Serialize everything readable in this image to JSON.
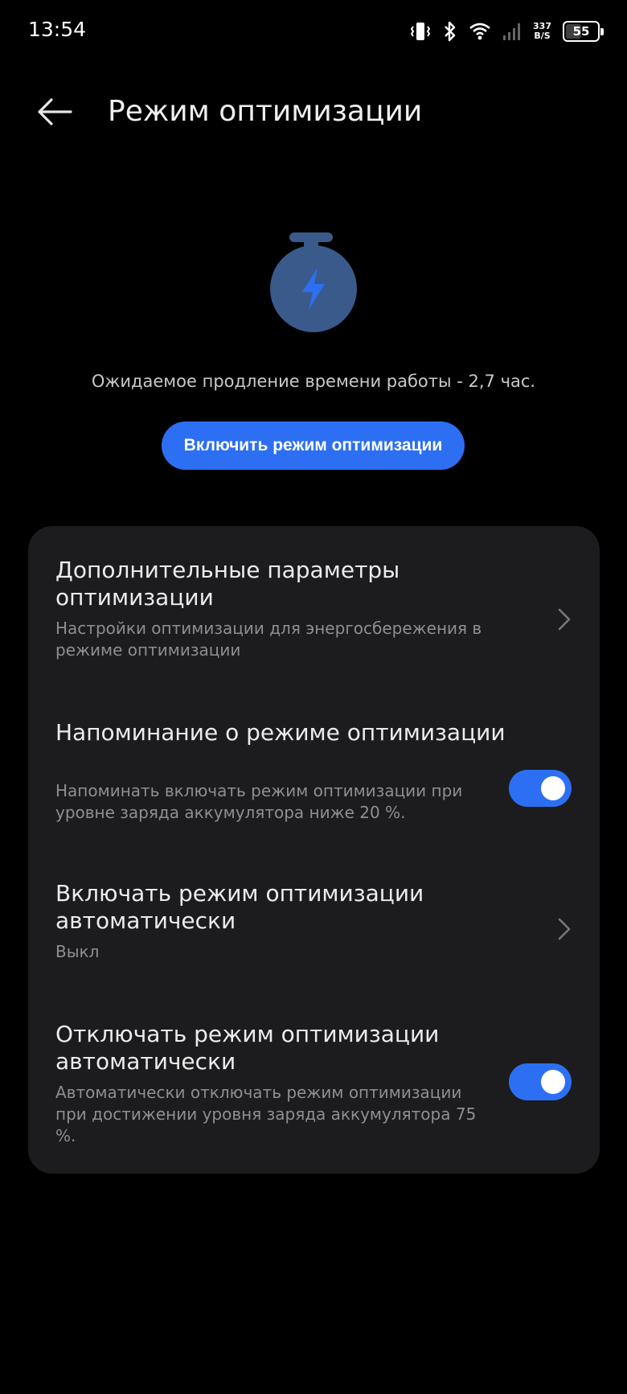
{
  "status_bar": {
    "time": "13:54",
    "net_speed_value": "337",
    "net_speed_unit": "B/S",
    "battery_level": "55",
    "icons": [
      "vibrate-icon",
      "bluetooth-icon",
      "wifi-icon",
      "signal-icon"
    ]
  },
  "header": {
    "title": "Режим оптимизации",
    "back_icon": "arrow-left-icon"
  },
  "hero": {
    "icon": "stopwatch-bolt-icon",
    "hint": "Ожидаемое продление времени работы - 2,7 час.",
    "button_label": "Включить режим оптимизации"
  },
  "settings": [
    {
      "title": "Дополнительные параметры оптимизации",
      "subtitle": "Настройки оптимизации для энергосбережения в режиме оптимизации",
      "control": "chevron"
    },
    {
      "title": "Напоминание о режиме оптимизации",
      "subtitle": "Напоминать включать режим оптимизации при уровне заряда аккумулятора ниже 20 %.",
      "control": "toggle",
      "enabled": true
    },
    {
      "title": "Включать режим оптимизации автоматически",
      "subtitle": "Выкл",
      "control": "chevron"
    },
    {
      "title": "Отключать режим оптимизации автоматически",
      "subtitle": "Автоматически отключать режим оптимизации при достижении уровня заряда аккумулятора 75 %.",
      "control": "toggle",
      "enabled": true
    }
  ],
  "colors": {
    "accent": "#2d6ff2",
    "card": "#1c1c1e",
    "background": "#000000",
    "hero_icon": "#3a5a8c"
  }
}
